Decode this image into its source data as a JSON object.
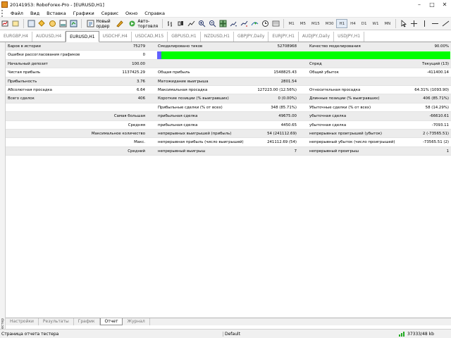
{
  "window": {
    "title": "20141953: RoboForex-Pro - [EURUSD,H1]",
    "minimize": "–",
    "maximize": "□",
    "close": "✕"
  },
  "menu": [
    "Файл",
    "Вид",
    "Вставка",
    "Графики",
    "Сервис",
    "Окно",
    "Справка"
  ],
  "toolbar": {
    "new_order": "Новый ордер",
    "autotrading": "Авто-торговля",
    "timeframes": [
      "M1",
      "M5",
      "M15",
      "M30",
      "H1",
      "H4",
      "D1",
      "W1",
      "MN"
    ],
    "active_timeframe": "H1"
  },
  "chart_tabs": [
    "EURGBP,H4",
    "AUDUSD,H4",
    "EURUSD,H1",
    "USDCHF,H4",
    "USDCAD,M15",
    "GBPUSD,H1",
    "NZDUSD,H1",
    "GBPJPY,Daily",
    "EURJPY,H1",
    "AUDJPY,Daily",
    "USDJPY,H1"
  ],
  "active_chart_tab": "EURUSD,H1",
  "report": {
    "rows": [
      [
        {
          "t": "Баров в истории",
          "a": "l",
          "c": 0
        },
        {
          "t": "75279",
          "a": "r",
          "c": 1
        },
        {
          "t": "Смоделировано тиков",
          "a": "l",
          "c": 2
        },
        {
          "t": "52708968",
          "a": "r",
          "c": 3
        },
        {
          "t": "Качество моделирования",
          "a": "l",
          "c": 4
        },
        {
          "t": "90.00%",
          "a": "r",
          "c": 5
        }
      ],
      [
        {
          "t": "Ошибки рассогласования графиков",
          "a": "l",
          "c": 0
        },
        {
          "t": "0",
          "a": "r",
          "c": 1
        }
      ],
      [
        {
          "t": "Начальный депозит",
          "a": "l",
          "c": 0
        },
        {
          "t": "100.00",
          "a": "r",
          "c": 1
        },
        {
          "t": "Спред",
          "a": "l",
          "c": 4
        },
        {
          "t": "Текущий (13)",
          "a": "r",
          "c": 5
        }
      ],
      [
        {
          "t": "Чистая прибыль",
          "a": "l",
          "c": 0
        },
        {
          "t": "1137425.29",
          "a": "r",
          "c": 1
        },
        {
          "t": "Общая прибыль",
          "a": "l",
          "c": 2
        },
        {
          "t": "1548825.43",
          "a": "r",
          "c": 3
        },
        {
          "t": "Общий убыток",
          "a": "l",
          "c": 4
        },
        {
          "t": "-411400.14",
          "a": "r",
          "c": 5
        }
      ],
      [
        {
          "t": "Прибыльность",
          "a": "l",
          "c": 0
        },
        {
          "t": "3.76",
          "a": "r",
          "c": 1
        },
        {
          "t": "Матожидание выигрыша",
          "a": "l",
          "c": 2
        },
        {
          "t": "2801.54",
          "a": "r",
          "c": 3
        }
      ],
      [
        {
          "t": "Абсолютная просадка",
          "a": "l",
          "c": 0
        },
        {
          "t": "6.64",
          "a": "r",
          "c": 1
        },
        {
          "t": "Максимальная просадка",
          "a": "l",
          "c": 2
        },
        {
          "t": "127223.00 (12.56%)",
          "a": "r",
          "c": 3
        },
        {
          "t": "Относительная просадка",
          "a": "l",
          "c": 4
        },
        {
          "t": "64.31% (1093.90)",
          "a": "r",
          "c": 5
        }
      ],
      [
        {
          "t": "Всего сделок",
          "a": "l",
          "c": 0
        },
        {
          "t": "406",
          "a": "r",
          "c": 1
        },
        {
          "t": "Короткие позиции (% выигравших)",
          "a": "l",
          "c": 2
        },
        {
          "t": "0 (0.00%)",
          "a": "r",
          "c": 3
        },
        {
          "t": "Длинные позиции (% выигравших)",
          "a": "l",
          "c": 4
        },
        {
          "t": "406 (85.71%)",
          "a": "r",
          "c": 5
        }
      ],
      [
        {
          "t": "Прибыльные сделки (% от всех)",
          "a": "l",
          "c": 2
        },
        {
          "t": "348 (85.71%)",
          "a": "r",
          "c": 3
        },
        {
          "t": "Убыточные сделки (% от всех)",
          "a": "l",
          "c": 4
        },
        {
          "t": "58 (14.29%)",
          "a": "r",
          "c": 5
        }
      ],
      [
        {
          "t": "Самая большая",
          "a": "r",
          "c": 1
        },
        {
          "t": "прибыльная сделка",
          "a": "l",
          "c": 2
        },
        {
          "t": "49675.00",
          "a": "r",
          "c": 3
        },
        {
          "t": "убыточная сделка",
          "a": "l",
          "c": 4
        },
        {
          "t": "-66610.61",
          "a": "r",
          "c": 5
        }
      ],
      [
        {
          "t": "Средняя",
          "a": "r",
          "c": 1
        },
        {
          "t": "прибыльная сделка",
          "a": "l",
          "c": 2
        },
        {
          "t": "4450.65",
          "a": "r",
          "c": 3
        },
        {
          "t": "убыточная сделка",
          "a": "l",
          "c": 4
        },
        {
          "t": "-7093.11",
          "a": "r",
          "c": 5
        }
      ],
      [
        {
          "t": "Максимальное количество",
          "a": "r",
          "c": 1
        },
        {
          "t": "непрерывных выигрышей (прибыль)",
          "a": "l",
          "c": 2
        },
        {
          "t": "54 (241112.69)",
          "a": "r",
          "c": 3
        },
        {
          "t": "непрерывных проигрышей (убыток)",
          "a": "l",
          "c": 4
        },
        {
          "t": "2 (-73565.51)",
          "a": "r",
          "c": 5
        }
      ],
      [
        {
          "t": "Макс.",
          "a": "r",
          "c": 1
        },
        {
          "t": "непрерывная прибыль (число выигрышей)",
          "a": "l",
          "c": 2
        },
        {
          "t": "241112.69 (54)",
          "a": "r",
          "c": 3
        },
        {
          "t": "непрерывный убыток (число проигрышей)",
          "a": "l",
          "c": 4
        },
        {
          "t": "-73565.51 (2)",
          "a": "r",
          "c": 5
        }
      ],
      [
        {
          "t": "Средний",
          "a": "r",
          "c": 1
        },
        {
          "t": "непрерывный выигрыш",
          "a": "l",
          "c": 2
        },
        {
          "t": "7",
          "a": "r",
          "c": 3
        },
        {
          "t": "непрерывный проигрыш",
          "a": "l",
          "c": 4
        },
        {
          "t": "1",
          "a": "r",
          "c": 5
        }
      ]
    ]
  },
  "bottom_tabs": [
    "Настройки",
    "Результаты",
    "График",
    "Отчет",
    "Журнал"
  ],
  "active_bottom_tab": "Отчет",
  "side_label": "Тестер",
  "status": {
    "left": "Страница отчета тестера",
    "profile": "Default",
    "connection": "37333/48 kb"
  },
  "colors": {
    "quality_bar": "#00ff00",
    "quality_bar_start": "#6060ff",
    "shaded_row": "#ececec"
  }
}
